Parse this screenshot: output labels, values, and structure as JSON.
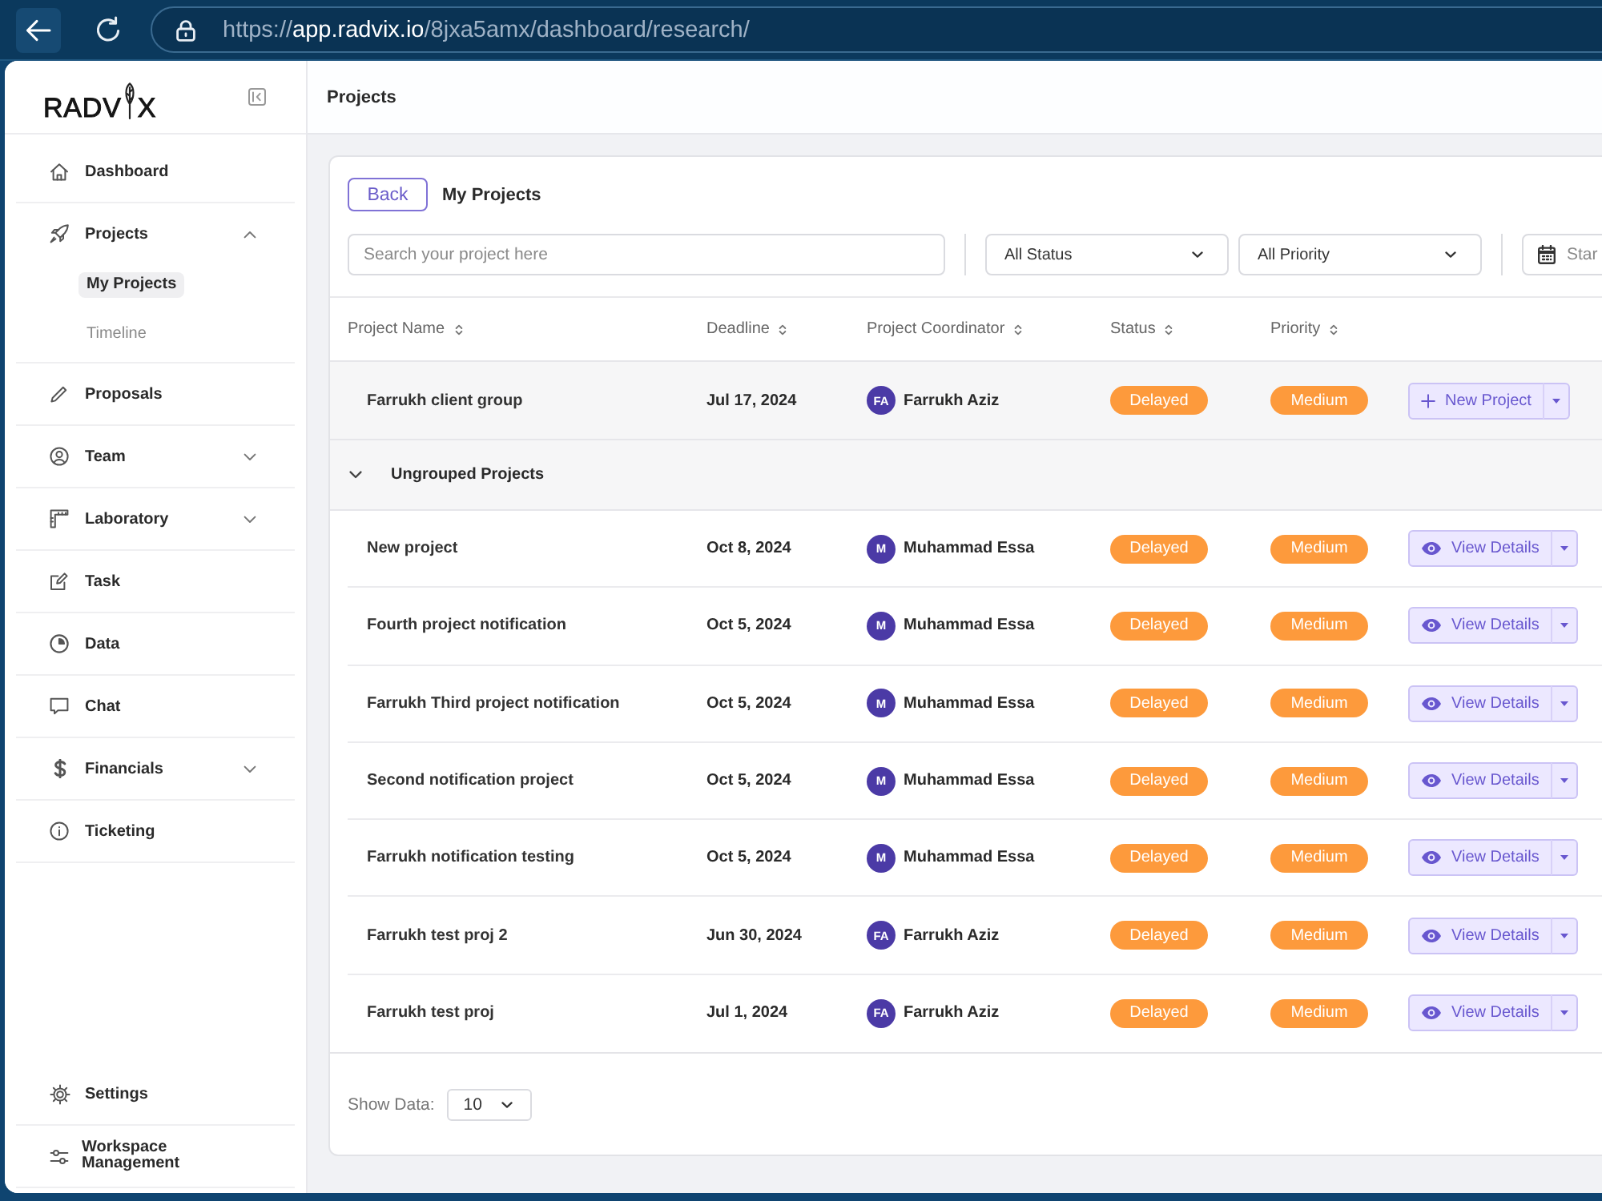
{
  "browser": {
    "url": {
      "scheme": "https://",
      "host": "app.radvix.io",
      "path": "/8jxa5amx/dashboard/research/"
    }
  },
  "sidebar": {
    "logo": {
      "before": "RADV",
      "after": "X"
    },
    "items": [
      {
        "kind": "link",
        "label": "Dashboard",
        "selected": false
      },
      {
        "kind": "menu",
        "label": "Projects",
        "selected": false,
        "expanded": true,
        "children": [
          {
            "label": "My Projects",
            "selected": true
          },
          {
            "label": "Timeline",
            "selected": false
          }
        ]
      },
      {
        "kind": "link",
        "label": "Proposals",
        "selected": false
      },
      {
        "kind": "menu",
        "label": "Team",
        "selected": false,
        "expanded": false
      },
      {
        "kind": "menu",
        "label": "Laboratory",
        "selected": false,
        "expanded": false
      },
      {
        "kind": "link",
        "label": "Task",
        "selected": false
      },
      {
        "kind": "link",
        "label": "Data",
        "selected": false
      },
      {
        "kind": "link",
        "label": "Chat",
        "selected": false
      },
      {
        "kind": "menu",
        "label": "Financials",
        "selected": false,
        "expanded": false
      },
      {
        "kind": "link",
        "label": "Ticketing",
        "selected": false
      }
    ],
    "footer_items": [
      {
        "label": "Settings",
        "selected": false
      },
      {
        "label": "Workspace Management",
        "selected": false
      }
    ]
  },
  "header": {
    "title": "Projects"
  },
  "card": {
    "back_button": "Back",
    "title": "My Projects",
    "search": {
      "placeholder": "Search your project here"
    },
    "filters": [
      {
        "kind": "select",
        "value": "All Status"
      },
      {
        "kind": "select",
        "value": "All Priority"
      },
      {
        "kind": "date",
        "placeholder": "Star"
      }
    ]
  },
  "table": {
    "columns": [
      "Project Name",
      "Deadline",
      "Project Coordinator",
      "Status",
      "Priority"
    ],
    "rows": [
      {
        "kind": "group",
        "name": "Farrukh client group",
        "deadline": "Jul 17, 2024",
        "coordinator": {
          "initials": "FA",
          "name": "Farrukh Aziz"
        },
        "status": "Delayed",
        "priority": "Medium",
        "action": "New Project"
      },
      {
        "kind": "section",
        "name": "Ungrouped Projects",
        "expanded": true
      },
      {
        "kind": "project",
        "name": "New project",
        "deadline": "Oct 8, 2024",
        "coordinator": {
          "initials": "M",
          "name": "Muhammad Essa"
        },
        "status": "Delayed",
        "priority": "Medium",
        "action": "View Details"
      },
      {
        "kind": "project",
        "name": "Fourth project notification",
        "deadline": "Oct 5, 2024",
        "coordinator": {
          "initials": "M",
          "name": "Muhammad Essa"
        },
        "status": "Delayed",
        "priority": "Medium",
        "action": "View Details"
      },
      {
        "kind": "project",
        "name": "Farrukh Third project notification",
        "deadline": "Oct 5, 2024",
        "coordinator": {
          "initials": "M",
          "name": "Muhammad Essa"
        },
        "status": "Delayed",
        "priority": "Medium",
        "action": "View Details"
      },
      {
        "kind": "project",
        "name": "Second notification project",
        "deadline": "Oct 5, 2024",
        "coordinator": {
          "initials": "M",
          "name": "Muhammad Essa"
        },
        "status": "Delayed",
        "priority": "Medium",
        "action": "View Details"
      },
      {
        "kind": "project",
        "name": "Farrukh notification testing",
        "deadline": "Oct 5, 2024",
        "coordinator": {
          "initials": "M",
          "name": "Muhammad Essa"
        },
        "status": "Delayed",
        "priority": "Medium",
        "action": "View Details"
      },
      {
        "kind": "project",
        "name": "Farrukh test proj 2",
        "deadline": "Jun 30, 2024",
        "coordinator": {
          "initials": "FA",
          "name": "Farrukh Aziz"
        },
        "status": "Delayed",
        "priority": "Medium",
        "action": "View Details"
      },
      {
        "kind": "project",
        "name": "Farrukh test proj",
        "deadline": "Jul 1, 2024",
        "coordinator": {
          "initials": "FA",
          "name": "Farrukh Aziz"
        },
        "status": "Delayed",
        "priority": "Medium",
        "action": "View Details"
      }
    ]
  },
  "pagination": {
    "label": "Show Data:",
    "value": "10"
  }
}
